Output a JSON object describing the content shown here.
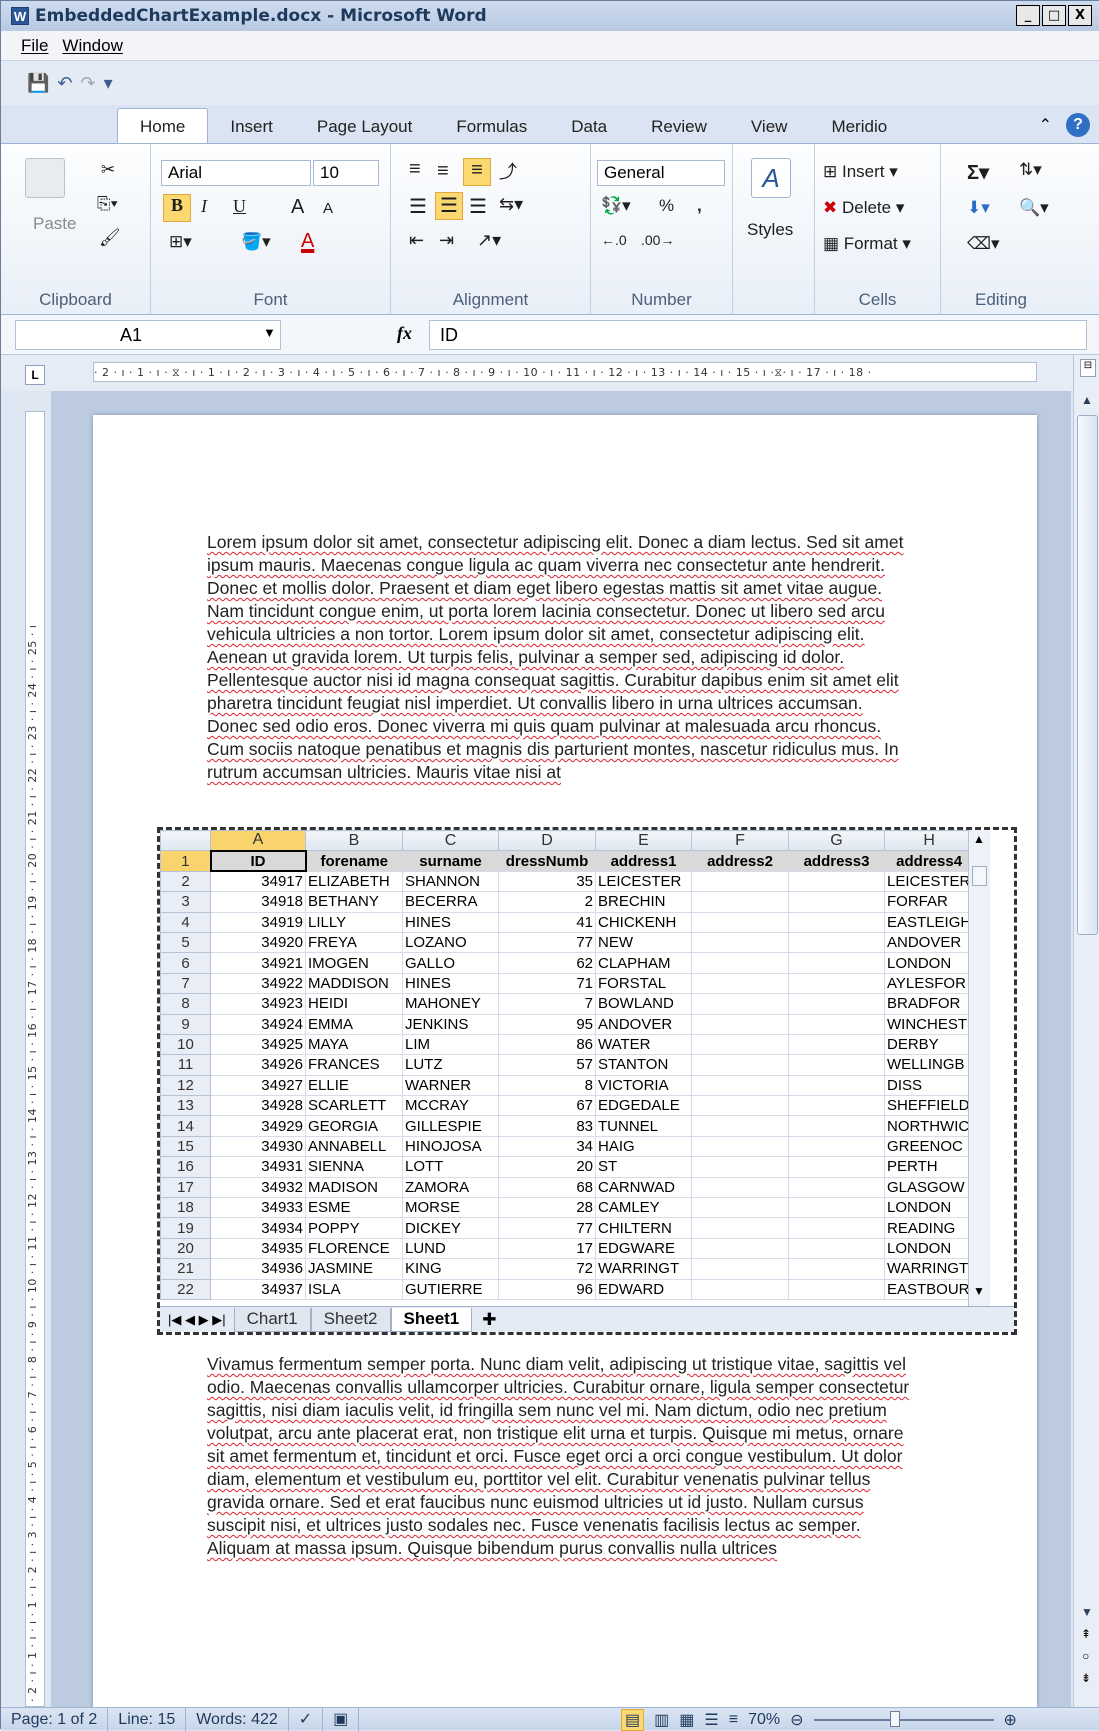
{
  "window": {
    "app_letter": "W",
    "title": "EmbeddedChartExample.docx - Microsoft Word",
    "minimize": "_",
    "restore": "□",
    "close": "X"
  },
  "menu": {
    "items": [
      "File",
      "Window"
    ]
  },
  "qat": {
    "save": "💾",
    "undo": "↶",
    "redo": "↷",
    "more": "▾"
  },
  "tabs": {
    "items": [
      "Home",
      "Insert",
      "Page Layout",
      "Formulas",
      "Data",
      "Review",
      "View",
      "Meridio"
    ],
    "active": "Home",
    "minimize": "⌃",
    "help": "?"
  },
  "ribbon": {
    "clipboard": {
      "label": "Clipboard",
      "paste": "Paste"
    },
    "font": {
      "label": "Font",
      "family": "Arial",
      "size": "10",
      "bold": "B",
      "italic": "I",
      "underline": "U",
      "grow": "A",
      "shrink": "A",
      "color": "A"
    },
    "alignment": {
      "label": "Alignment"
    },
    "number": {
      "label": "Number",
      "format": "General",
      "percent": "%",
      "comma": ","
    },
    "styles": {
      "label": "Styles"
    },
    "cells": {
      "label": "Cells",
      "insert": "Insert",
      "delete": "Delete",
      "format": "Format"
    },
    "editing": {
      "label": "Editing",
      "sum": "Σ"
    }
  },
  "formula": {
    "name": "A1",
    "fx": "fx",
    "value": "ID"
  },
  "ruler": {
    "text": "· 2 · ı · 1 · ı · ⧖ · ı · 1 · ı · 2 · ı · 3 · ı · 4 · ı · 5 · ı · 6 · ı · 7 · ı · 8 · ı · 9 · ı · 10 · ı · 11 · ı · 12 · ı · 13 · ı · 14 · ı · 15 · ı ·⧖· ı · 17 · ı · 18 ·",
    "vtext": "· 2 · ı · 1 · ı · ı · 1 · ı · 2 · ı · 3 · ı · 4 · ı · 5 · ı · 6 · ı · 7 · ı · 8 · ı · 9 · ı · 10 · ı · 11 · ı · 12 · ı · 13 · ı · 14 · ı · 15 · ı · 16 · ı · 17 · ı · 18 · ı · 19 · ı · 20 · ı · 21 · ı · 22 · ı · 23 · ı · 24 · ı · 25 · ı"
  },
  "doc": {
    "para1": "Lorem ipsum dolor sit amet, consectetur adipiscing elit. Donec a diam lectus. Sed sit amet ipsum mauris. Maecenas congue ligula ac quam viverra nec consectetur ante hendrerit. Donec et mollis dolor. Praesent et diam eget libero egestas mattis sit amet vitae augue. Nam tincidunt congue enim, ut porta lorem lacinia consectetur. Donec ut libero sed arcu vehicula ultricies a non tortor. Lorem ipsum dolor sit amet, consectetur adipiscing elit. Aenean ut gravida lorem. Ut turpis felis, pulvinar a semper sed, adipiscing id dolor. Pellentesque auctor nisi id magna consequat sagittis. Curabitur dapibus enim sit amet elit pharetra tincidunt feugiat nisl imperdiet. Ut convallis libero in urna ultrices accumsan. Donec sed odio eros. Donec viverra mi quis quam pulvinar at malesuada arcu rhoncus. Cum sociis natoque penatibus et magnis dis parturient montes, nascetur ridiculus mus. In rutrum accumsan ultricies. Mauris vitae nisi at",
    "para2": "Vivamus fermentum semper porta. Nunc diam velit, adipiscing ut tristique vitae, sagittis vel odio. Maecenas convallis ullamcorper ultricies. Curabitur ornare, ligula semper consectetur sagittis, nisi diam iaculis velit, id fringilla sem nunc vel mi. Nam dictum, odio nec pretium volutpat, arcu ante placerat erat, non tristique elit urna et turpis. Quisque mi metus, ornare sit amet fermentum et, tincidunt et orci. Fusce eget orci a orci congue vestibulum. Ut dolor diam, elementum et vestibulum eu, porttitor vel elit. Curabitur venenatis pulvinar tellus gravida ornare. Sed et erat faucibus nunc euismod ultricies ut id justo. Nullam cursus suscipit nisi, et ultrices justo sodales nec. Fusce venenatis facilisis lectus ac semper. Aliquam at massa ipsum. Quisque bibendum purus convallis nulla ultrices"
  },
  "sheet": {
    "columns": [
      "A",
      "B",
      "C",
      "D",
      "E",
      "F",
      "G",
      "H"
    ],
    "header": [
      "ID",
      "forename",
      "surname",
      "dressNumb",
      "address1",
      "address2",
      "address3",
      "address4"
    ],
    "rows": [
      [
        "34917",
        "ELIZABETH",
        "SHANNON",
        "35",
        "LEICESTER",
        "",
        "",
        "LEICESTER"
      ],
      [
        "34918",
        "BETHANY",
        "BECERRA",
        "2",
        "BRECHIN",
        "",
        "",
        "FORFAR"
      ],
      [
        "34919",
        "LILLY",
        "HINES",
        "41",
        "CHICKENH",
        "",
        "",
        "EASTLEIGH"
      ],
      [
        "34920",
        "FREYA",
        "LOZANO",
        "77",
        "NEW",
        "",
        "",
        "ANDOVER"
      ],
      [
        "34921",
        "IMOGEN",
        "GALLO",
        "62",
        "CLAPHAM",
        "",
        "",
        "LONDON"
      ],
      [
        "34922",
        "MADDISON",
        "HINES",
        "71",
        "FORSTAL",
        "",
        "",
        "AYLESFOR"
      ],
      [
        "34923",
        "HEIDI",
        "MAHONEY",
        "7",
        "BOWLAND",
        "",
        "",
        "BRADFOR"
      ],
      [
        "34924",
        "EMMA",
        "JENKINS",
        "95",
        "ANDOVER",
        "",
        "",
        "WINCHEST"
      ],
      [
        "34925",
        "MAYA",
        "LIM",
        "86",
        "WATER",
        "",
        "",
        "DERBY"
      ],
      [
        "34926",
        "FRANCES",
        "LUTZ",
        "57",
        "STANTON",
        "",
        "",
        "WELLINGB"
      ],
      [
        "34927",
        "ELLIE",
        "WARNER",
        "8",
        "VICTORIA",
        "",
        "",
        "DISS"
      ],
      [
        "34928",
        "SCARLETT",
        "MCCRAY",
        "67",
        "EDGEDALE",
        "",
        "",
        "SHEFFIELD"
      ],
      [
        "34929",
        "GEORGIA",
        "GILLESPIE",
        "83",
        "TUNNEL",
        "",
        "",
        "NORTHWIC"
      ],
      [
        "34930",
        "ANNABELL",
        "HINOJOSA",
        "34",
        "HAIG",
        "",
        "",
        "GREENOC"
      ],
      [
        "34931",
        "SIENNA",
        "LOTT",
        "20",
        "ST",
        "",
        "",
        "PERTH"
      ],
      [
        "34932",
        "MADISON",
        "ZAMORA",
        "68",
        "CARNWAD",
        "",
        "",
        "GLASGOW"
      ],
      [
        "34933",
        "ESME",
        "MORSE",
        "28",
        "CAMLEY",
        "",
        "",
        "LONDON"
      ],
      [
        "34934",
        "POPPY",
        "DICKEY",
        "77",
        "CHILTERN",
        "",
        "",
        "READING"
      ],
      [
        "34935",
        "FLORENCE",
        "LUND",
        "17",
        "EDGWARE",
        "",
        "",
        "LONDON"
      ],
      [
        "34936",
        "JASMINE",
        "KING",
        "72",
        "WARRINGT",
        "",
        "",
        "WARRINGT"
      ],
      [
        "34937",
        "ISLA",
        "GUTIERRE",
        "96",
        "EDWARD",
        "",
        "",
        "EASTBOUR"
      ]
    ],
    "tabs": [
      "Chart1",
      "Sheet2",
      "Sheet1"
    ],
    "active_tab": "Sheet1"
  },
  "status": {
    "page": "Page: 1 of 2",
    "line": "Line: 15",
    "words": "Words: 422",
    "zoom": "70%"
  }
}
